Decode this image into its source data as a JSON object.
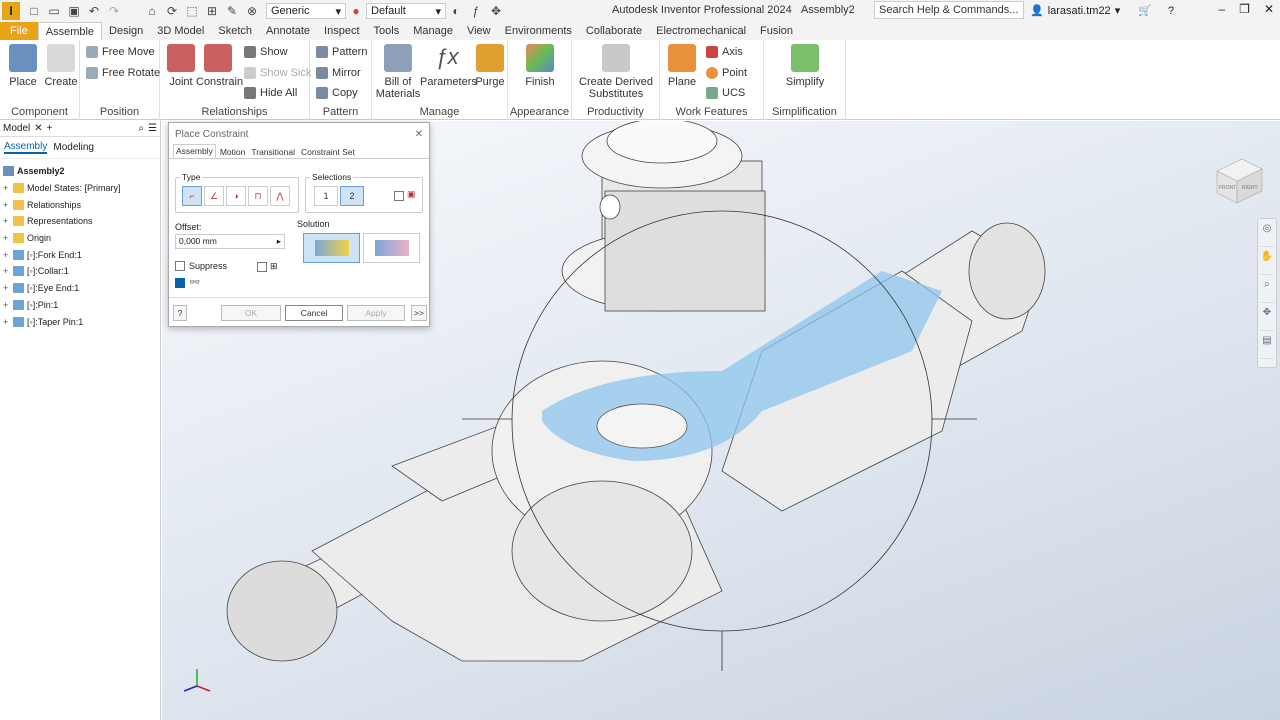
{
  "qat": {
    "logo": "I",
    "appearance_value": "Generic",
    "material_value": "Default",
    "app_title": "Autodesk Inventor Professional 2024",
    "doc_title": "Assembly2",
    "search_placeholder": "Search Help & Commands...",
    "user": "larasati.tm22"
  },
  "tabs": [
    "File",
    "Assemble",
    "Design",
    "3D Model",
    "Sketch",
    "Annotate",
    "Inspect",
    "Tools",
    "Manage",
    "View",
    "Environments",
    "Collaborate",
    "Electromechanical",
    "Fusion"
  ],
  "ribbon": {
    "component": {
      "label": "Component",
      "place": "Place",
      "create": "Create"
    },
    "position": {
      "label": "Position",
      "free_move": "Free Move",
      "free_rotate": "Free Rotate"
    },
    "relationships": {
      "label": "Relationships",
      "joint": "Joint",
      "constrain": "Constrain",
      "show": "Show",
      "show_sick": "Show Sick",
      "hide_all": "Hide All"
    },
    "pattern": {
      "label": "Pattern",
      "pattern": "Pattern",
      "mirror": "Mirror",
      "copy": "Copy"
    },
    "manage": {
      "label": "Manage",
      "bom_line1": "Bill of",
      "bom_line2": "Materials",
      "parameters": "Parameters",
      "purge": "Purge"
    },
    "appearance": {
      "label": "Appearance",
      "finish": "Finish"
    },
    "productivity": {
      "label": "Productivity",
      "cds_line1": "Create Derived",
      "cds_line2": "Substitutes"
    },
    "work_features": {
      "label": "Work Features",
      "plane": "Plane",
      "axis": "Axis",
      "point": "Point",
      "ucs": "UCS"
    },
    "simplification": {
      "label": "Simplification",
      "simplify": "Simplify"
    }
  },
  "browser": {
    "header": "Model",
    "tab_assembly": "Assembly",
    "tab_modeling": "Modeling",
    "root": "Assembly2",
    "items": [
      {
        "label": "Model States: [Primary]",
        "type": "folder"
      },
      {
        "label": "Relationships",
        "type": "folder"
      },
      {
        "label": "Representations",
        "type": "folder"
      },
      {
        "label": "Origin",
        "type": "folder"
      },
      {
        "label": "[◦]:Fork End:1",
        "type": "part"
      },
      {
        "label": "[◦]:Collar:1",
        "type": "part"
      },
      {
        "label": "[◦]:Eye End:1",
        "type": "part"
      },
      {
        "label": "[◦]:Pin:1",
        "type": "part"
      },
      {
        "label": "[◦]:Taper Pin:1",
        "type": "part"
      }
    ]
  },
  "dialog": {
    "title": "Place Constraint",
    "tabs": [
      "Assembly",
      "Motion",
      "Transitional",
      "Constraint Set"
    ],
    "type_label": "Type",
    "selections_label": "Selections",
    "sel1": "1",
    "sel2": "2",
    "offset_label": "Offset:",
    "offset_value": "0,000 mm",
    "solution_label": "Solution",
    "suppress_label": "Suppress",
    "ok": "OK",
    "cancel": "Cancel",
    "apply": "Apply",
    "more": ">>",
    "help": "?"
  },
  "viewcube": {
    "front": "FRONT",
    "right": "RIGHT"
  },
  "colors": {
    "accent": "#e8a317",
    "highlight": "#8ec5ec",
    "part": "#e8e8e8"
  }
}
